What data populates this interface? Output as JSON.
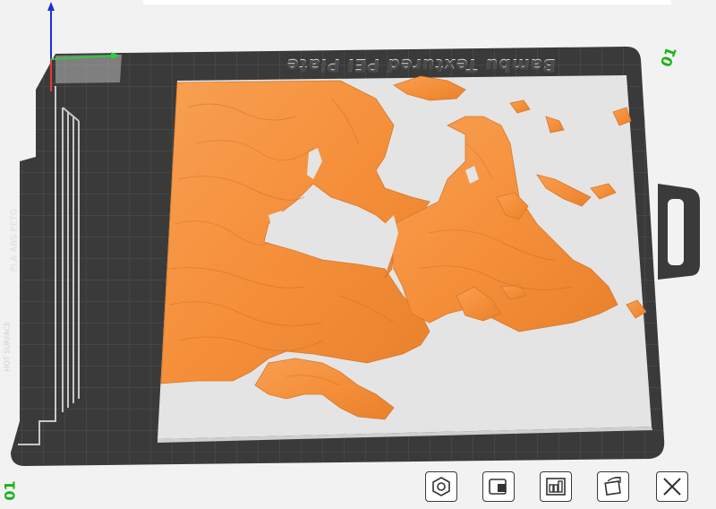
{
  "plate": {
    "title": "Bambu Textured PEI Plate",
    "number": "01",
    "side_label": "PLA ABS PETG",
    "surface_label": "HOT SURFACE",
    "corner_number": "01"
  },
  "colors": {
    "plate": "#3a3a3a",
    "grid": "#555555",
    "model": "#f58f3a",
    "base": "#e6e6e6",
    "axis_x": "#e53935",
    "axis_y": "#2ecc40",
    "axis_z": "#1e2fd8",
    "label_green": "#19b219"
  },
  "toolbar": {
    "buttons": [
      {
        "name": "orient-button",
        "icon": "hexagon-nut-icon"
      },
      {
        "name": "arrange-button",
        "icon": "plate-object-icon"
      },
      {
        "name": "layout-button",
        "icon": "grid-layout-icon"
      },
      {
        "name": "auto-orient-button",
        "icon": "rotate-cube-icon"
      },
      {
        "name": "close-button",
        "icon": "close-icon"
      }
    ]
  }
}
